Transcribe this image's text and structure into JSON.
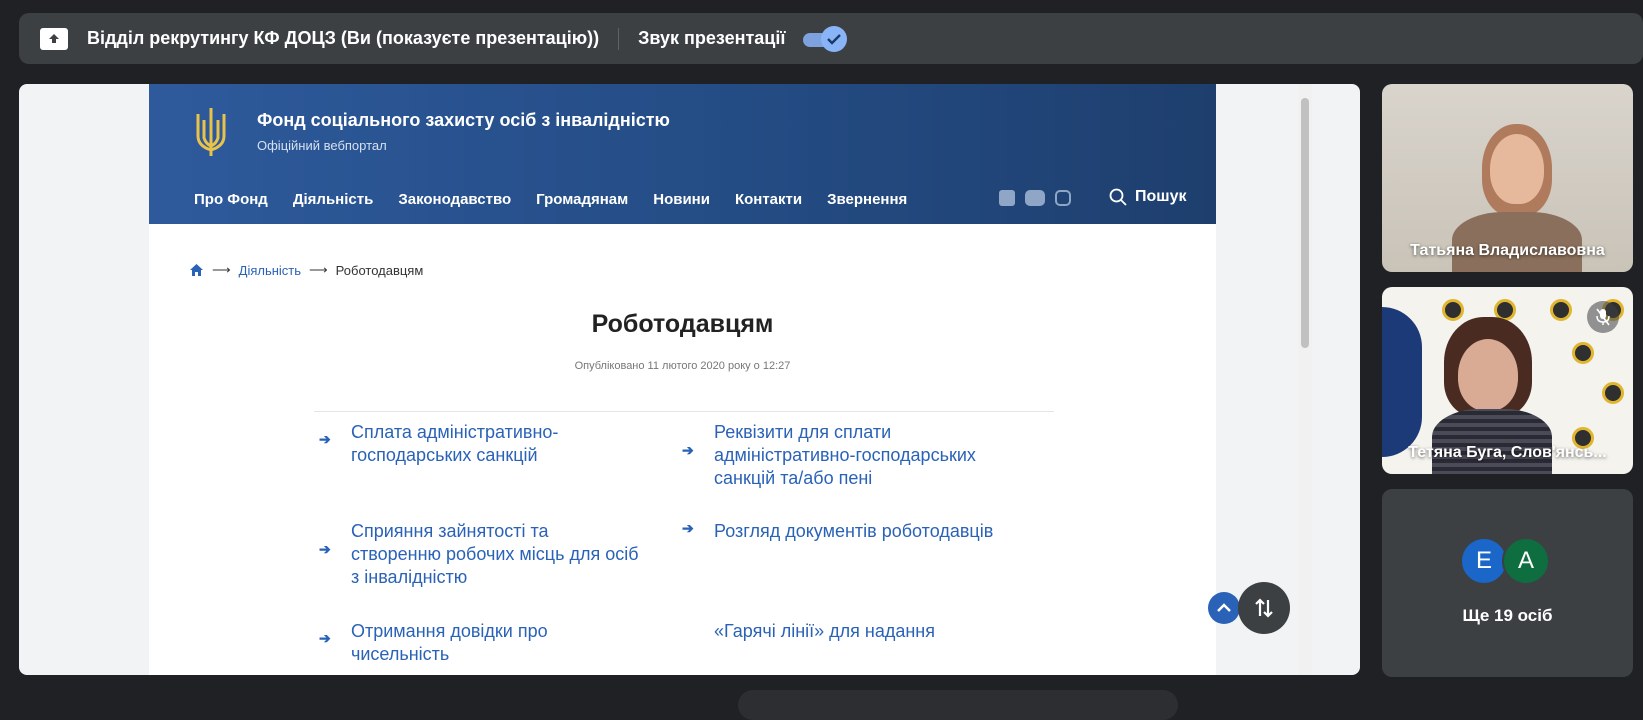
{
  "topbar": {
    "presenter_label": "Відділ рекрутингу КФ ДОЦЗ (Ви (показуєте презентацію))",
    "sound_label": "Звук презентації",
    "sound_enabled": true
  },
  "site": {
    "title": "Фонд соціального захисту осіб з інвалідністю",
    "subtitle": "Офіційний вебпортал",
    "nav": [
      "Про Фонд",
      "Діяльність",
      "Законодавство",
      "Громадянам",
      "Новини",
      "Контакти",
      "Звернення"
    ],
    "socials": [
      "facebook-icon",
      "youtube-icon",
      "instagram-icon"
    ],
    "search_label": "Пошук",
    "breadcrumb": {
      "separator": "⟶",
      "link": "Діяльність",
      "current": "Роботодавцям"
    },
    "page_title": "Роботодавцям",
    "published": "Опубліковано 11 лютого 2020 року о 12:27",
    "items": [
      "Сплата адміністративно-господарських санкцій",
      "Реквізити для сплати адміністративно-господарських санкцій та/або пені",
      "Сприяння зайнятості та створенню робочих місць для осіб з інвалідністю",
      "Розгляд документів роботодавців",
      "Отримання довідки про чисельність",
      "«Гарячі лінії» для надання"
    ]
  },
  "participants": {
    "tile1_name": "Татьяна Владиславовна",
    "tile2_name": "Тетяна Буга, Слов'янсь...",
    "more_avatars": [
      "E",
      "A"
    ],
    "more_label": "Ще 19 осіб"
  },
  "colors": {
    "header_blue": "#2e5a9c",
    "link_blue": "#2a62b8",
    "meet_dark": "#202124",
    "toggle_blue": "#8ab4f8"
  }
}
